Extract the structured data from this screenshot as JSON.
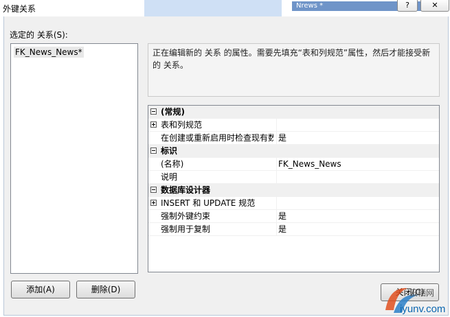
{
  "window": {
    "title": "外键关系",
    "help_label": "?",
    "close_label": "✕",
    "bg_window_title": "Nrews *"
  },
  "list": {
    "label": "选定的 关系(S):",
    "items": [
      "FK_News_News*"
    ]
  },
  "description": "正在编辑新的 关系 的属性。需要先填充“表和列规范”属性，然后才能接受新的 关系。",
  "grid": {
    "rows": [
      {
        "kind": "cat",
        "name": "(常规)"
      },
      {
        "kind": "prop",
        "expandable": true,
        "name": "表和列规范",
        "value": ""
      },
      {
        "kind": "prop",
        "expandable": false,
        "name": "在创建或重新启用时检查现有数据",
        "value": "是"
      },
      {
        "kind": "cat",
        "name": "标识"
      },
      {
        "kind": "prop",
        "expandable": false,
        "name": "(名称)",
        "value": "FK_News_News"
      },
      {
        "kind": "prop",
        "expandable": false,
        "name": "说明",
        "value": ""
      },
      {
        "kind": "cat",
        "name": "数据库设计器"
      },
      {
        "kind": "prop",
        "expandable": true,
        "name": "INSERT 和 UPDATE 规范",
        "value": ""
      },
      {
        "kind": "prop",
        "expandable": false,
        "name": "强制外键约束",
        "value": "是"
      },
      {
        "kind": "prop",
        "expandable": false,
        "name": "强制用于复制",
        "value": "是"
      }
    ]
  },
  "buttons": {
    "add": "添加(A)",
    "delete": "删除(D)",
    "close": "关闭(C)"
  },
  "watermark": {
    "text": "iyunv.com",
    "text2": "云栖网"
  },
  "colors": {
    "grid_category_bg": "#f0f0f0",
    "dialog_bg": "#f0f0f0",
    "watermark": "#0b66b0"
  }
}
